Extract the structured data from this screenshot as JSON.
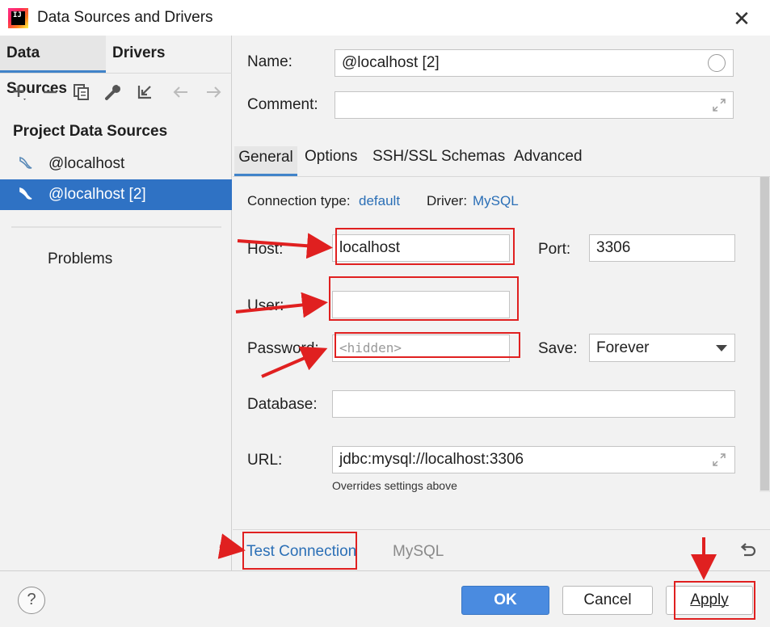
{
  "window": {
    "title": "Data Sources and Drivers",
    "close_glyph": "✕"
  },
  "left_panel": {
    "tabs": [
      "Data Sources",
      "Drivers"
    ],
    "toolbar": [
      "add-icon",
      "remove-icon",
      "copy-icon",
      "wrench-icon",
      "import-icon",
      "back-icon",
      "forward-icon"
    ],
    "section_title": "Project Data Sources",
    "items": [
      {
        "label": "@localhost",
        "selected": false
      },
      {
        "label": "@localhost [2]",
        "selected": true
      }
    ],
    "problems_label": "Problems"
  },
  "form": {
    "name_label": "Name:",
    "name_value": "@localhost [2]",
    "comment_label": "Comment:",
    "comment_value": "",
    "tabs": [
      "General",
      "Options",
      "SSH/SSL",
      "Schemas",
      "Advanced"
    ],
    "active_tab": "General",
    "connection_type_label": "Connection type:",
    "connection_type_value": "default",
    "driver_label": "Driver:",
    "driver_value": "MySQL",
    "host_label": "Host:",
    "host_value": "localhost",
    "port_label": "Port:",
    "port_value": "3306",
    "user_label": "User:",
    "user_value": "",
    "password_label": "Password:",
    "password_placeholder": "<hidden>",
    "save_label": "Save:",
    "save_value": "Forever",
    "database_label": "Database:",
    "database_value": "",
    "url_label": "URL:",
    "url_value": "jdbc:mysql://localhost:3306",
    "url_note": "Overrides settings above",
    "test_connection": "Test Connection",
    "driver_tab": "MySQL"
  },
  "footer": {
    "help": "?",
    "ok": "OK",
    "cancel": "Cancel",
    "apply": "Apply"
  },
  "colors": {
    "accent": "#2f72c4",
    "link": "#2b6fb6",
    "annotation": "#e02020",
    "ok_button": "#4a8be0"
  }
}
